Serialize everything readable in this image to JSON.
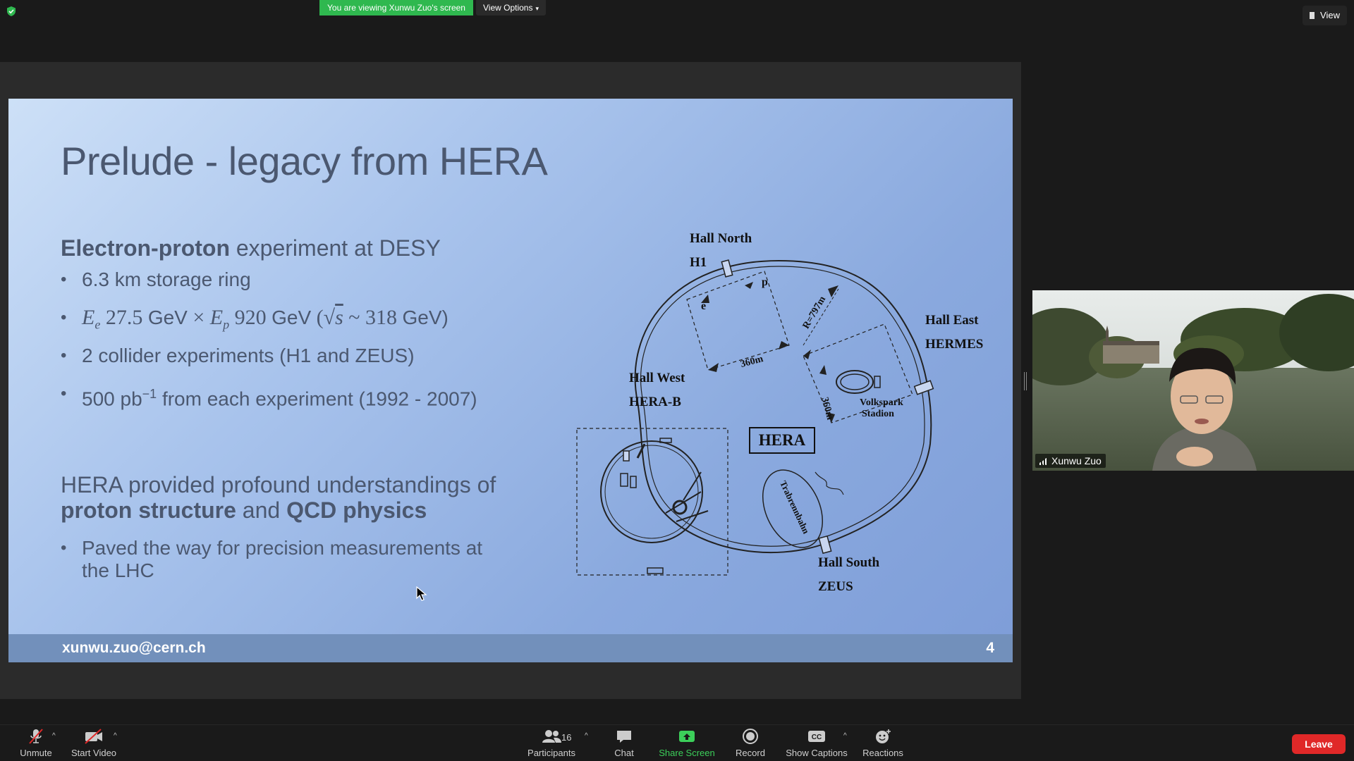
{
  "top_bar": {
    "viewing_banner": "You are viewing Xunwu Zuo's screen",
    "view_options_label": "View Options",
    "view_label": "View"
  },
  "slide": {
    "title": "Prelude - legacy from HERA",
    "subhead_bold": "Electron-proton",
    "subhead_rest": " experiment at DESY",
    "bullets": {
      "b1": "6.3 km storage ring",
      "b2": {
        "e_sym": "E",
        "e_sub": "e",
        "e_val": " 27.5 ",
        "unit1": "GeV",
        "times": " × ",
        "p_sym": "E",
        "p_sub": "p",
        "p_val": " 920 ",
        "unit2": "GeV",
        "paren_open": " (",
        "sqrt": "√",
        "s": "s",
        "approx": " ~ 318 ",
        "unit3": "GeV)"
      },
      "b3": "2 collider experiments (H1 and ZEUS)",
      "b4_pre": "500 pb",
      "b4_sup": "−1",
      "b4_post": " from each experiment (1992 - 2007)"
    },
    "para2": {
      "line1": "HERA provided profound understandings of",
      "bold1": "proton structure",
      "mid": " and ",
      "bold2": "QCD physics"
    },
    "bullet_final": "Paved the way for precision measurements at the LHC",
    "diagram": {
      "hall_north": "Hall North",
      "h1": "H1",
      "hall_east": "Hall East",
      "hermes": "HERMES",
      "hall_west": "Hall West",
      "hera_b": "HERA-B",
      "hall_south": "Hall South",
      "zeus": "ZEUS",
      "hera": "HERA",
      "e_label": "e",
      "p_label": "p",
      "dist_360_a": "360m",
      "dist_360_b": "360m",
      "radius": "R=797m",
      "volkspark_1": "Volkspark",
      "volkspark_2": "Stadion",
      "trabrennbahn": "Trabrennbahn"
    },
    "footer_email": "xunwu.zuo@cern.ch",
    "page_number": "4"
  },
  "participant": {
    "name": "Xunwu Zuo"
  },
  "toolbar": {
    "unmute": "Unmute",
    "start_video": "Start Video",
    "participants": "Participants",
    "participants_count": "16",
    "chat": "Chat",
    "share_screen": "Share Screen",
    "record": "Record",
    "show_captions": "Show Captions",
    "cc_glyph": "CC",
    "reactions": "Reactions",
    "leave": "Leave"
  },
  "colors": {
    "banner_green": "#2fb84f",
    "share_green": "#3ccf5a",
    "leave_red": "#e02828",
    "slide_text": "#4b5870",
    "footer_bar": "#7290bb"
  }
}
